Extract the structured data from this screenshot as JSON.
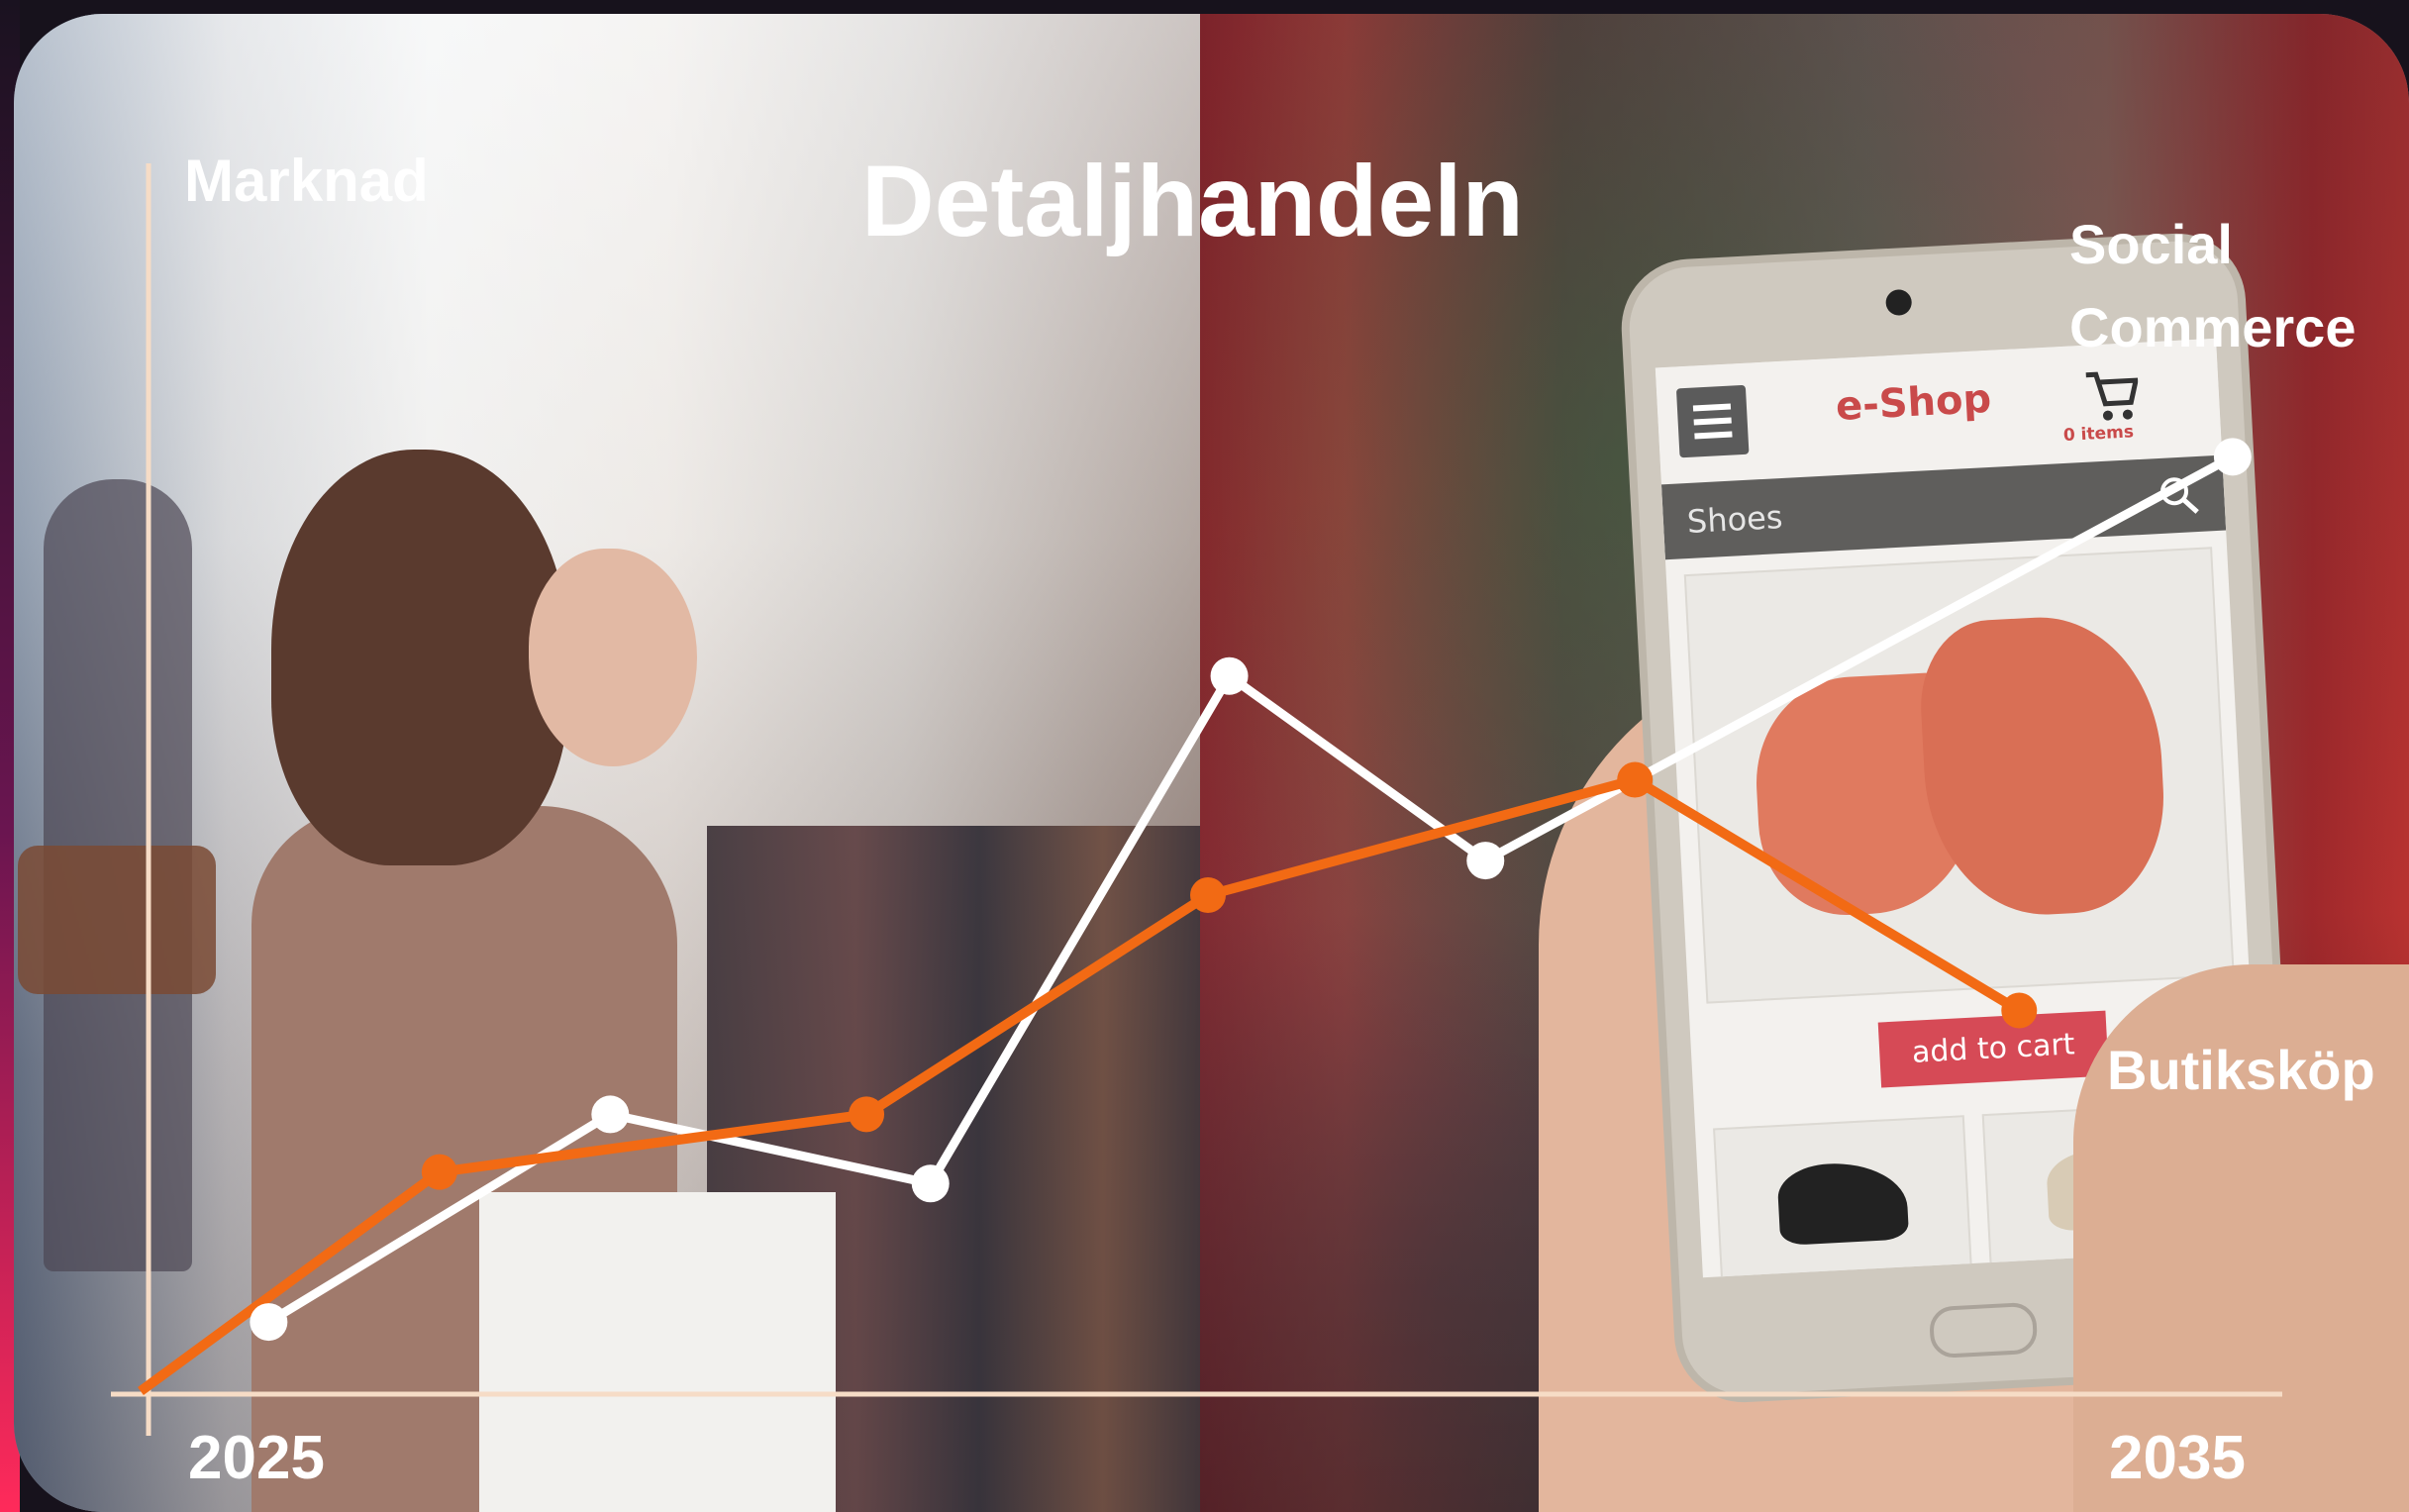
{
  "chart_data": {
    "type": "line",
    "title": "Detaljhandeln",
    "ylabel": "Marknad",
    "x_tick_labels": [
      "2025",
      "2035"
    ],
    "xlim": [
      2025,
      2035
    ],
    "ylim": [
      0,
      100
    ],
    "grid": false,
    "legend": "inline labels at line ends",
    "series": [
      {
        "name": "Social Commerce",
        "color": "#ffffff",
        "x": [
          2025.6,
          2027.2,
          2028.7,
          2030.1,
          2031.3,
          2034.8
        ],
        "y": [
          6,
          24,
          18,
          62,
          46,
          81
        ]
      },
      {
        "name": "Butiksköp",
        "color": "#f26a14",
        "x": [
          2025,
          2026.4,
          2028.4,
          2030.0,
          2032.0,
          2033.8
        ],
        "y": [
          0,
          19,
          24,
          43,
          53,
          33
        ]
      }
    ]
  },
  "scene": {
    "phone": {
      "shop_title": "e-Shop",
      "cart_count": "0 items",
      "search_text": "Shoes",
      "button_label": "add to cart"
    }
  }
}
